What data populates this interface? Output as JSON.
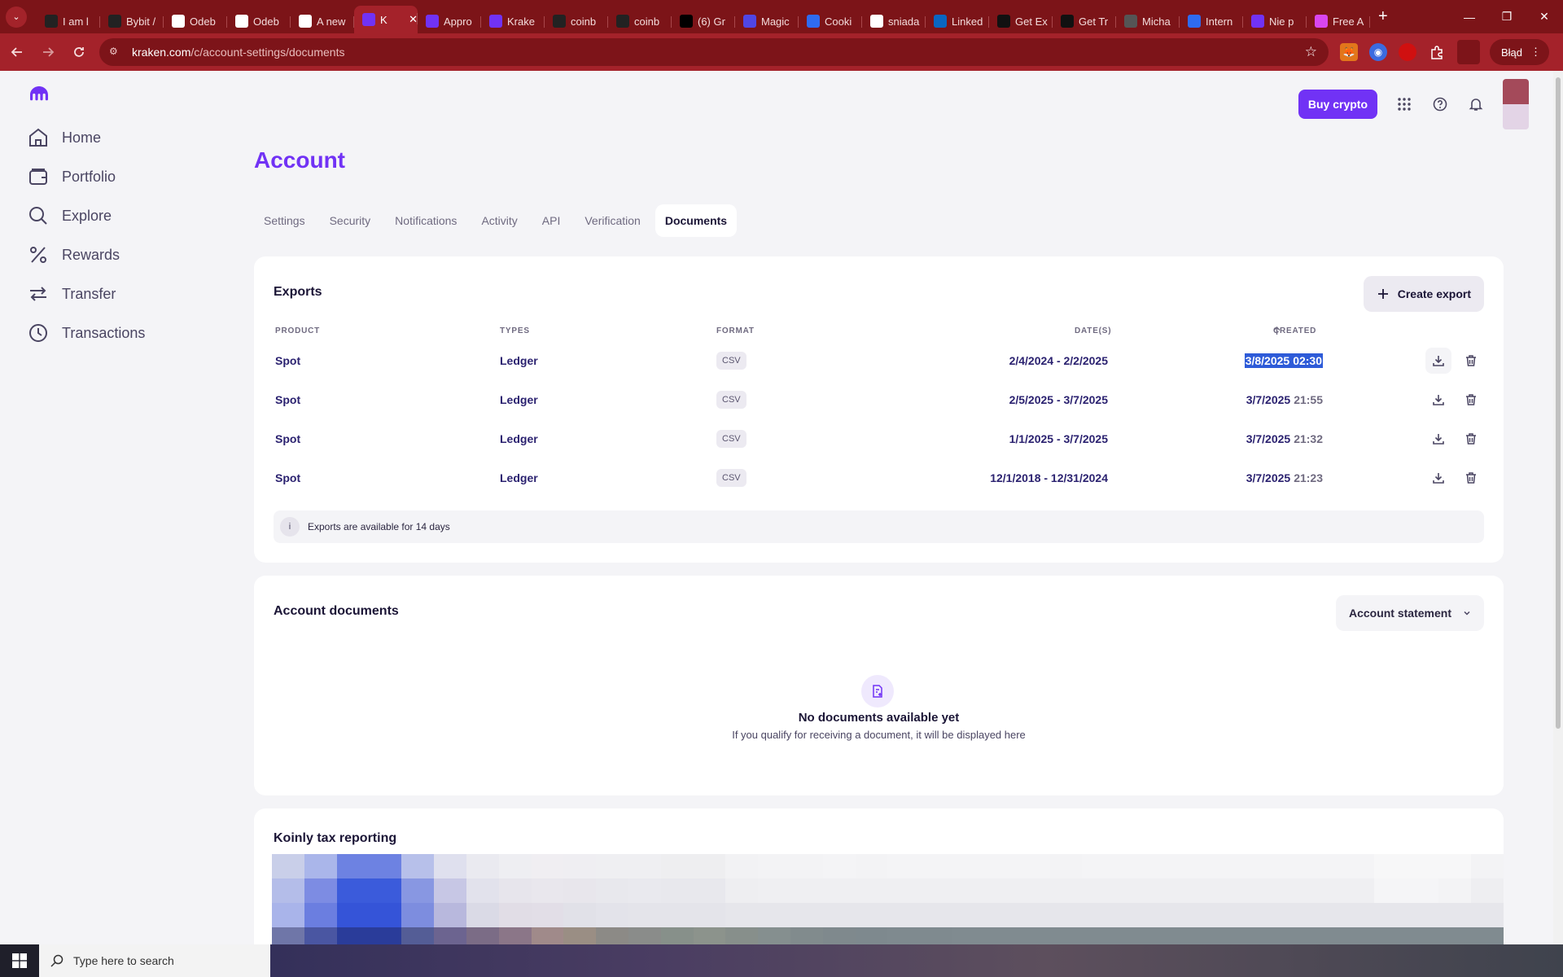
{
  "browser": {
    "tabs": [
      {
        "title": "I am l",
        "fav": "circle-icon",
        "color": "#222222"
      },
      {
        "title": "Bybit /",
        "fav": "bybit-icon",
        "color": "#222222"
      },
      {
        "title": "Odeb",
        "fav": "gmail-icon",
        "color": "#ffffff"
      },
      {
        "title": "Odeb",
        "fav": "gmail-icon",
        "color": "#ffffff"
      },
      {
        "title": "A new",
        "fav": "gmail-icon",
        "color": "#ffffff"
      },
      {
        "title": "K",
        "fav": "kraken-icon",
        "color": "#7132f5",
        "active": true
      },
      {
        "title": "Appro",
        "fav": "kraken-icon",
        "color": "#7132f5"
      },
      {
        "title": "Krake",
        "fav": "kraken-icon",
        "color": "#7132f5"
      },
      {
        "title": "coinb",
        "fav": "github-icon",
        "color": "#222222"
      },
      {
        "title": "coinb",
        "fav": "github-icon",
        "color": "#222222"
      },
      {
        "title": "(6) Gr",
        "fav": "x-icon",
        "color": "#000000"
      },
      {
        "title": "Magic",
        "fav": "magic-icon",
        "color": "#5046e5"
      },
      {
        "title": "Cooki",
        "fav": "at-icon",
        "color": "#2f6bf0"
      },
      {
        "title": "sniada",
        "fav": "google-icon",
        "color": "#ffffff"
      },
      {
        "title": "Linked",
        "fav": "linkedin-icon",
        "color": "#0a66c2"
      },
      {
        "title": "Get Ex",
        "fav": "bybit-icon",
        "color": "#111111"
      },
      {
        "title": "Get Tr",
        "fav": "bybit-icon",
        "color": "#111111"
      },
      {
        "title": "Micha",
        "fav": "github-icon",
        "color": "#555555"
      },
      {
        "title": "Intern",
        "fav": "at-icon",
        "color": "#2f6bf0"
      },
      {
        "title": "Nie p",
        "fav": "kraken-icon",
        "color": "#7132f5"
      },
      {
        "title": "Free A",
        "fav": "ai-icon",
        "color": "#d946ef"
      }
    ],
    "url_host": "kraken.com",
    "url_path": "/c/account-settings/documents",
    "error_label": "Błąd"
  },
  "header": {
    "buy_label": "Buy crypto"
  },
  "sidebar": {
    "items": [
      {
        "label": "Home",
        "icon": "home-icon"
      },
      {
        "label": "Portfolio",
        "icon": "wallet-icon"
      },
      {
        "label": "Explore",
        "icon": "search-icon"
      },
      {
        "label": "Rewards",
        "icon": "percent-icon"
      },
      {
        "label": "Transfer",
        "icon": "transfer-icon"
      },
      {
        "label": "Transactions",
        "icon": "clock-icon"
      }
    ]
  },
  "page": {
    "title": "Account",
    "tabs": [
      "Settings",
      "Security",
      "Notifications",
      "Activity",
      "API",
      "Verification",
      "Documents"
    ],
    "active_tab": "Documents"
  },
  "exports": {
    "title": "Exports",
    "create_label": "Create export",
    "columns": {
      "product": "PRODUCT",
      "types": "TYPES",
      "format": "FORMAT",
      "dates": "DATE(S)",
      "created": "CREATED"
    },
    "rows": [
      {
        "product": "Spot",
        "type": "Ledger",
        "format": "CSV",
        "dates": "2/4/2024 - 2/2/2025",
        "created_date": "3/8/2025",
        "created_time": "02:30"
      },
      {
        "product": "Spot",
        "type": "Ledger",
        "format": "CSV",
        "dates": "2/5/2025 - 3/7/2025",
        "created_date": "3/7/2025",
        "created_time": "21:55"
      },
      {
        "product": "Spot",
        "type": "Ledger",
        "format": "CSV",
        "dates": "1/1/2025 - 3/7/2025",
        "created_date": "3/7/2025",
        "created_time": "21:32"
      },
      {
        "product": "Spot",
        "type": "Ledger",
        "format": "CSV",
        "dates": "12/1/2018 - 12/31/2024",
        "created_date": "3/7/2025",
        "created_time": "21:23"
      }
    ],
    "info": "Exports are available for 14 days"
  },
  "account_documents": {
    "title": "Account documents",
    "dropdown_label": "Account statement",
    "empty_title": "No documents available yet",
    "empty_sub": "If you qualify for receiving a document, it will be displayed here"
  },
  "koinly": {
    "title": "Koinly tax reporting"
  },
  "taskbar": {
    "search_placeholder": "Type here to search"
  },
  "colors": {
    "accent": "#7132f5",
    "browser_frame": "#a4222a",
    "selection": "#2e5bd8"
  }
}
